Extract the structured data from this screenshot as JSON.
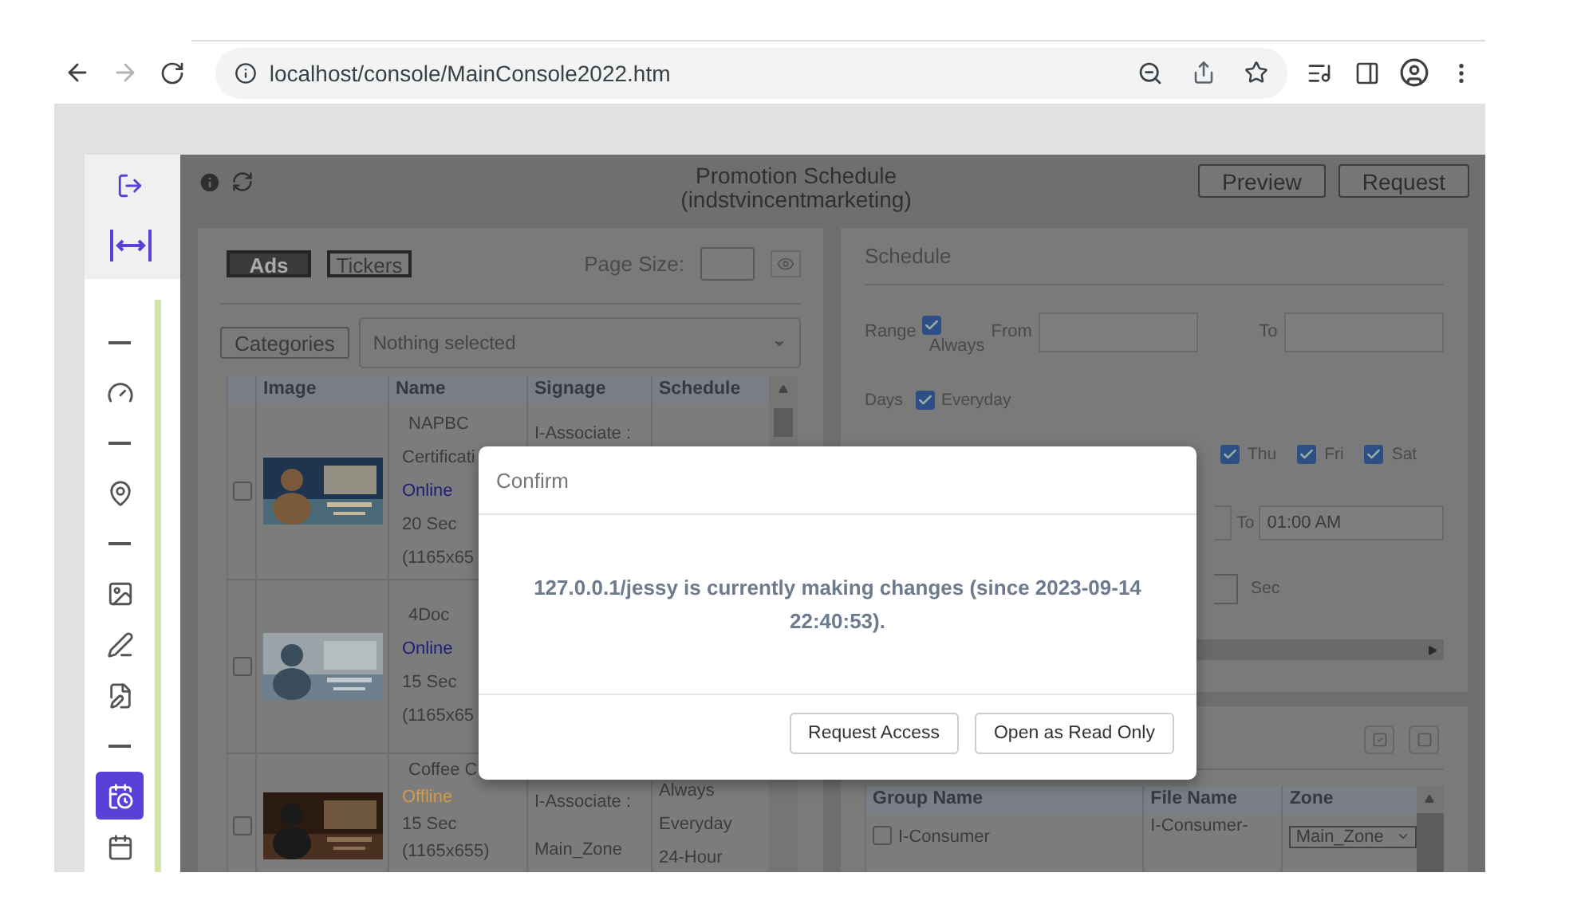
{
  "browser": {
    "url": "localhost/console/MainConsole2022.htm"
  },
  "sidebar": {
    "items": [
      {
        "kind": "separator"
      },
      {
        "kind": "icon",
        "selected": false
      },
      {
        "kind": "separator"
      },
      {
        "kind": "icon",
        "selected": false
      },
      {
        "kind": "separator"
      },
      {
        "kind": "icon",
        "selected": false
      },
      {
        "kind": "icon",
        "selected": false
      },
      {
        "kind": "icon",
        "selected": false
      },
      {
        "kind": "separator"
      },
      {
        "kind": "icon",
        "selected": true
      },
      {
        "kind": "icon",
        "selected": false
      }
    ]
  },
  "header": {
    "title": "Promotion Schedule",
    "subtitle": "(indstvincentmarketing)",
    "buttons": [
      "Preview",
      "Request"
    ]
  },
  "ads_panel": {
    "tabs": [
      {
        "label": "Ads",
        "selected": true
      },
      {
        "label": "Tickers",
        "selected": false
      }
    ],
    "page_size_label": "Page Size:",
    "categories_button": "Categories",
    "category_select": {
      "placeholder": "Nothing selected"
    },
    "table": {
      "columns": [
        "Image",
        "Name",
        "Signage",
        "Schedule"
      ],
      "rows": [
        {
          "checked": false,
          "name_lines": [
            "NAPBC",
            "Certificati"
          ],
          "status": {
            "text": "Online",
            "kind": "online"
          },
          "details": [
            "20 Sec",
            "(1165x65"
          ],
          "signage": [
            "I-Associate :"
          ],
          "schedule": []
        },
        {
          "checked": false,
          "name_lines": [
            "4Doc"
          ],
          "status": {
            "text": "Online",
            "kind": "online"
          },
          "details": [
            "15 Sec",
            "(1165x65"
          ],
          "signage": [],
          "schedule": []
        },
        {
          "checked": false,
          "name_lines": [
            "Coffee C"
          ],
          "status": {
            "text": "Offline",
            "kind": "offline"
          },
          "details": [
            "15 Sec",
            "(1165x655)"
          ],
          "signage": [
            "I-Associate :",
            "Main_Zone"
          ],
          "schedule": [
            "Always",
            "Everyday",
            "24-Hour"
          ]
        }
      ]
    }
  },
  "schedule_panel": {
    "title": "Schedule",
    "range": {
      "label": "Range",
      "always": {
        "label": "Always",
        "checked": true
      },
      "from_label": "From",
      "to_label": "To"
    },
    "days": {
      "label": "Days",
      "everyday": {
        "label": "Everyday",
        "checked": true
      },
      "weekdays": [
        {
          "label": "Thu",
          "checked": true
        },
        {
          "label": "Fri",
          "checked": true
        },
        {
          "label": "Sat",
          "checked": true
        }
      ]
    },
    "time": {
      "to_label": "To",
      "to_value": "01:00 AM"
    },
    "duration": {
      "unit": "Sec"
    }
  },
  "zones_panel": {
    "columns": [
      "Group Name",
      "File Name",
      "Zone"
    ],
    "rows": [
      {
        "checked": false,
        "group": "I-Consumer",
        "file": "I-Consumer-",
        "zone": "Main_Zone"
      }
    ]
  },
  "dialog": {
    "title": "Confirm",
    "message": "127.0.0.1/jessy is currently making changes (since 2023-09-14 22:40:53).",
    "buttons": [
      "Request Access",
      "Open as Read Only"
    ]
  }
}
